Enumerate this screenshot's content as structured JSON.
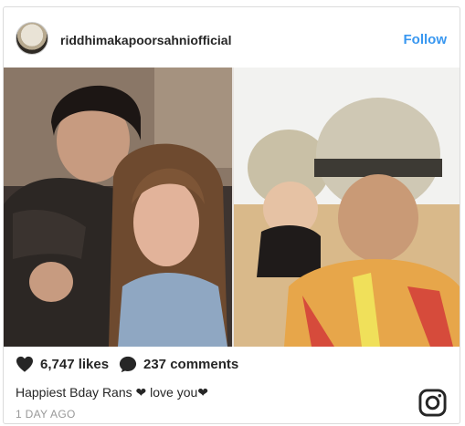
{
  "post": {
    "username": "riddhimakapoorsahniofficial",
    "follow_label": "Follow",
    "likes": "6,747 likes",
    "comments": "237 comments",
    "caption": "Happiest Bday Rans ❤ love you❤",
    "timestamp": "1 DAY AGO"
  },
  "icons": {
    "like": "heart-icon",
    "comment": "comment-bubble-icon",
    "brand": "instagram-logo-icon"
  },
  "colors": {
    "follow_blue": "#3897f0",
    "text": "#262626",
    "muted": "#999999"
  }
}
